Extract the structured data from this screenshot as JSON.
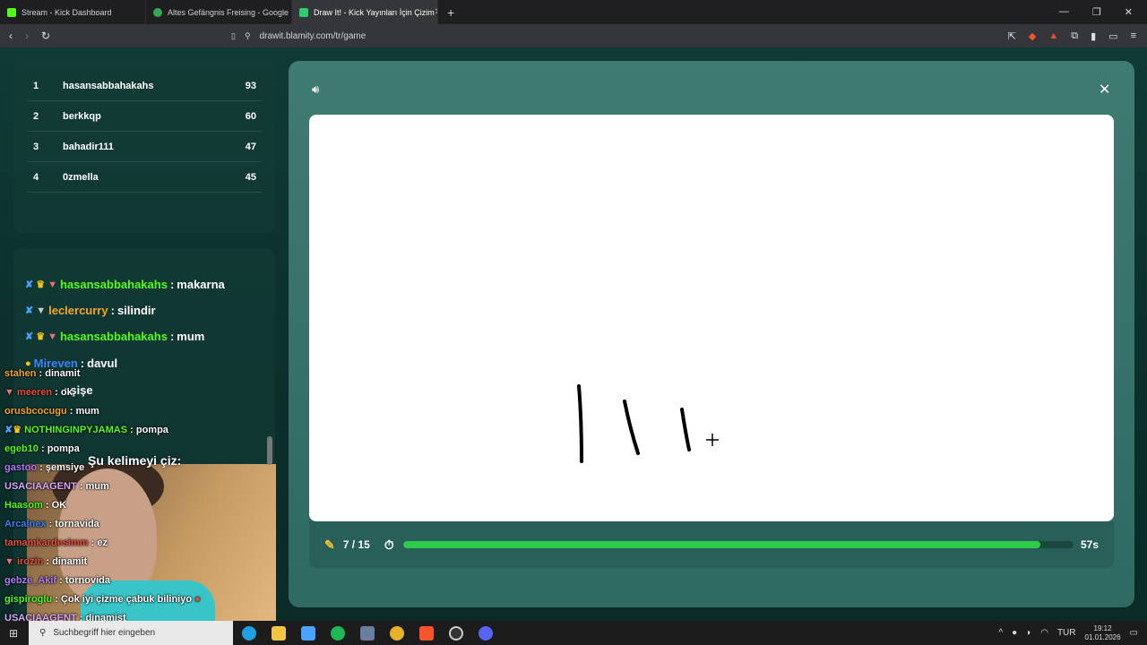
{
  "browser": {
    "tabs": [
      {
        "title": "Stream - Kick Dashboard",
        "icon": "kick-icon",
        "color": "#53fc18"
      },
      {
        "title": "Altes Gefängnis Freising - Google Ha",
        "icon": "maps-pin-icon",
        "color": "#34a853"
      },
      {
        "title": "Draw It! - Kick Yayınları İçin Çizim",
        "icon": "drawit-icon",
        "color": "#2ecc71",
        "active": true
      }
    ],
    "url": "drawit.blamity.com/tr/game"
  },
  "leaderboard": [
    {
      "rank": "1",
      "name": "hasansabbahakahs",
      "score": "93"
    },
    {
      "rank": "2",
      "name": "berkkqp",
      "score": "60"
    },
    {
      "rank": "3",
      "name": "bahadir111",
      "score": "47"
    },
    {
      "rank": "4",
      "name": "0zmella",
      "score": "45"
    }
  ],
  "guesses": [
    {
      "name": "hasansabbahakahs",
      "word": "makarna",
      "color": "#53fc18"
    },
    {
      "name": "leclercurry",
      "word": "silindir",
      "color": "#f5a623"
    },
    {
      "name": "hasansabbahakahs",
      "word": "mum",
      "color": "#53fc18"
    },
    {
      "name": "Mireven",
      "word": "davul",
      "color": "#3b82f6"
    },
    {
      "name": "",
      "word": "şişe",
      "color": "#e74c3c"
    }
  ],
  "overlay_chat": [
    {
      "user": "stahen",
      "msg": "dinamit",
      "color": "#f5a623"
    },
    {
      "user": "meeren",
      "msg": "ok",
      "color": "#e74c3c"
    },
    {
      "user": "orusbcocugu",
      "msg": "mum",
      "color": "#f5a623"
    },
    {
      "user": "NOTHINGINPYJAMAS",
      "msg": "pompa",
      "color": "#53fc18"
    },
    {
      "user": "egeb10",
      "msg": "pompa",
      "color": "#53fc18"
    },
    {
      "user": "gastoo",
      "msg": "şemsiye",
      "color": "#b07cf5"
    },
    {
      "user": "USACIAAGENT",
      "msg": "mum",
      "color": "#d7a8f5"
    },
    {
      "user": "Haasom",
      "msg": "OK",
      "color": "#53fc18"
    },
    {
      "user": "Arcalnex",
      "msg": "tornavida",
      "color": "#3b82f6"
    },
    {
      "user": "tamamkardesimm",
      "msg": "ez",
      "color": "#e74c3c"
    },
    {
      "user": "irozin",
      "msg": "dinamit",
      "color": "#e74c3c"
    },
    {
      "user": "gebze_Akif",
      "msg": "tornovida",
      "color": "#b07cf5"
    },
    {
      "user": "gispiroglu",
      "msg": "Çok iyi çizme çabuk biliniyo",
      "color": "#53fc18"
    },
    {
      "user": "USACIAAGENT",
      "msg": "dinamişt",
      "color": "#d7a8f5"
    }
  ],
  "cam_title": "Şu kelimeyi çiz:",
  "game": {
    "round": "7 / 15",
    "time_left": "57s",
    "time_progress": 0.95
  },
  "taskbar": {
    "search_placeholder": "Suchbegriff hier eingeben",
    "lang": "TUR",
    "time": "19:12",
    "date": "01.01.2026"
  }
}
